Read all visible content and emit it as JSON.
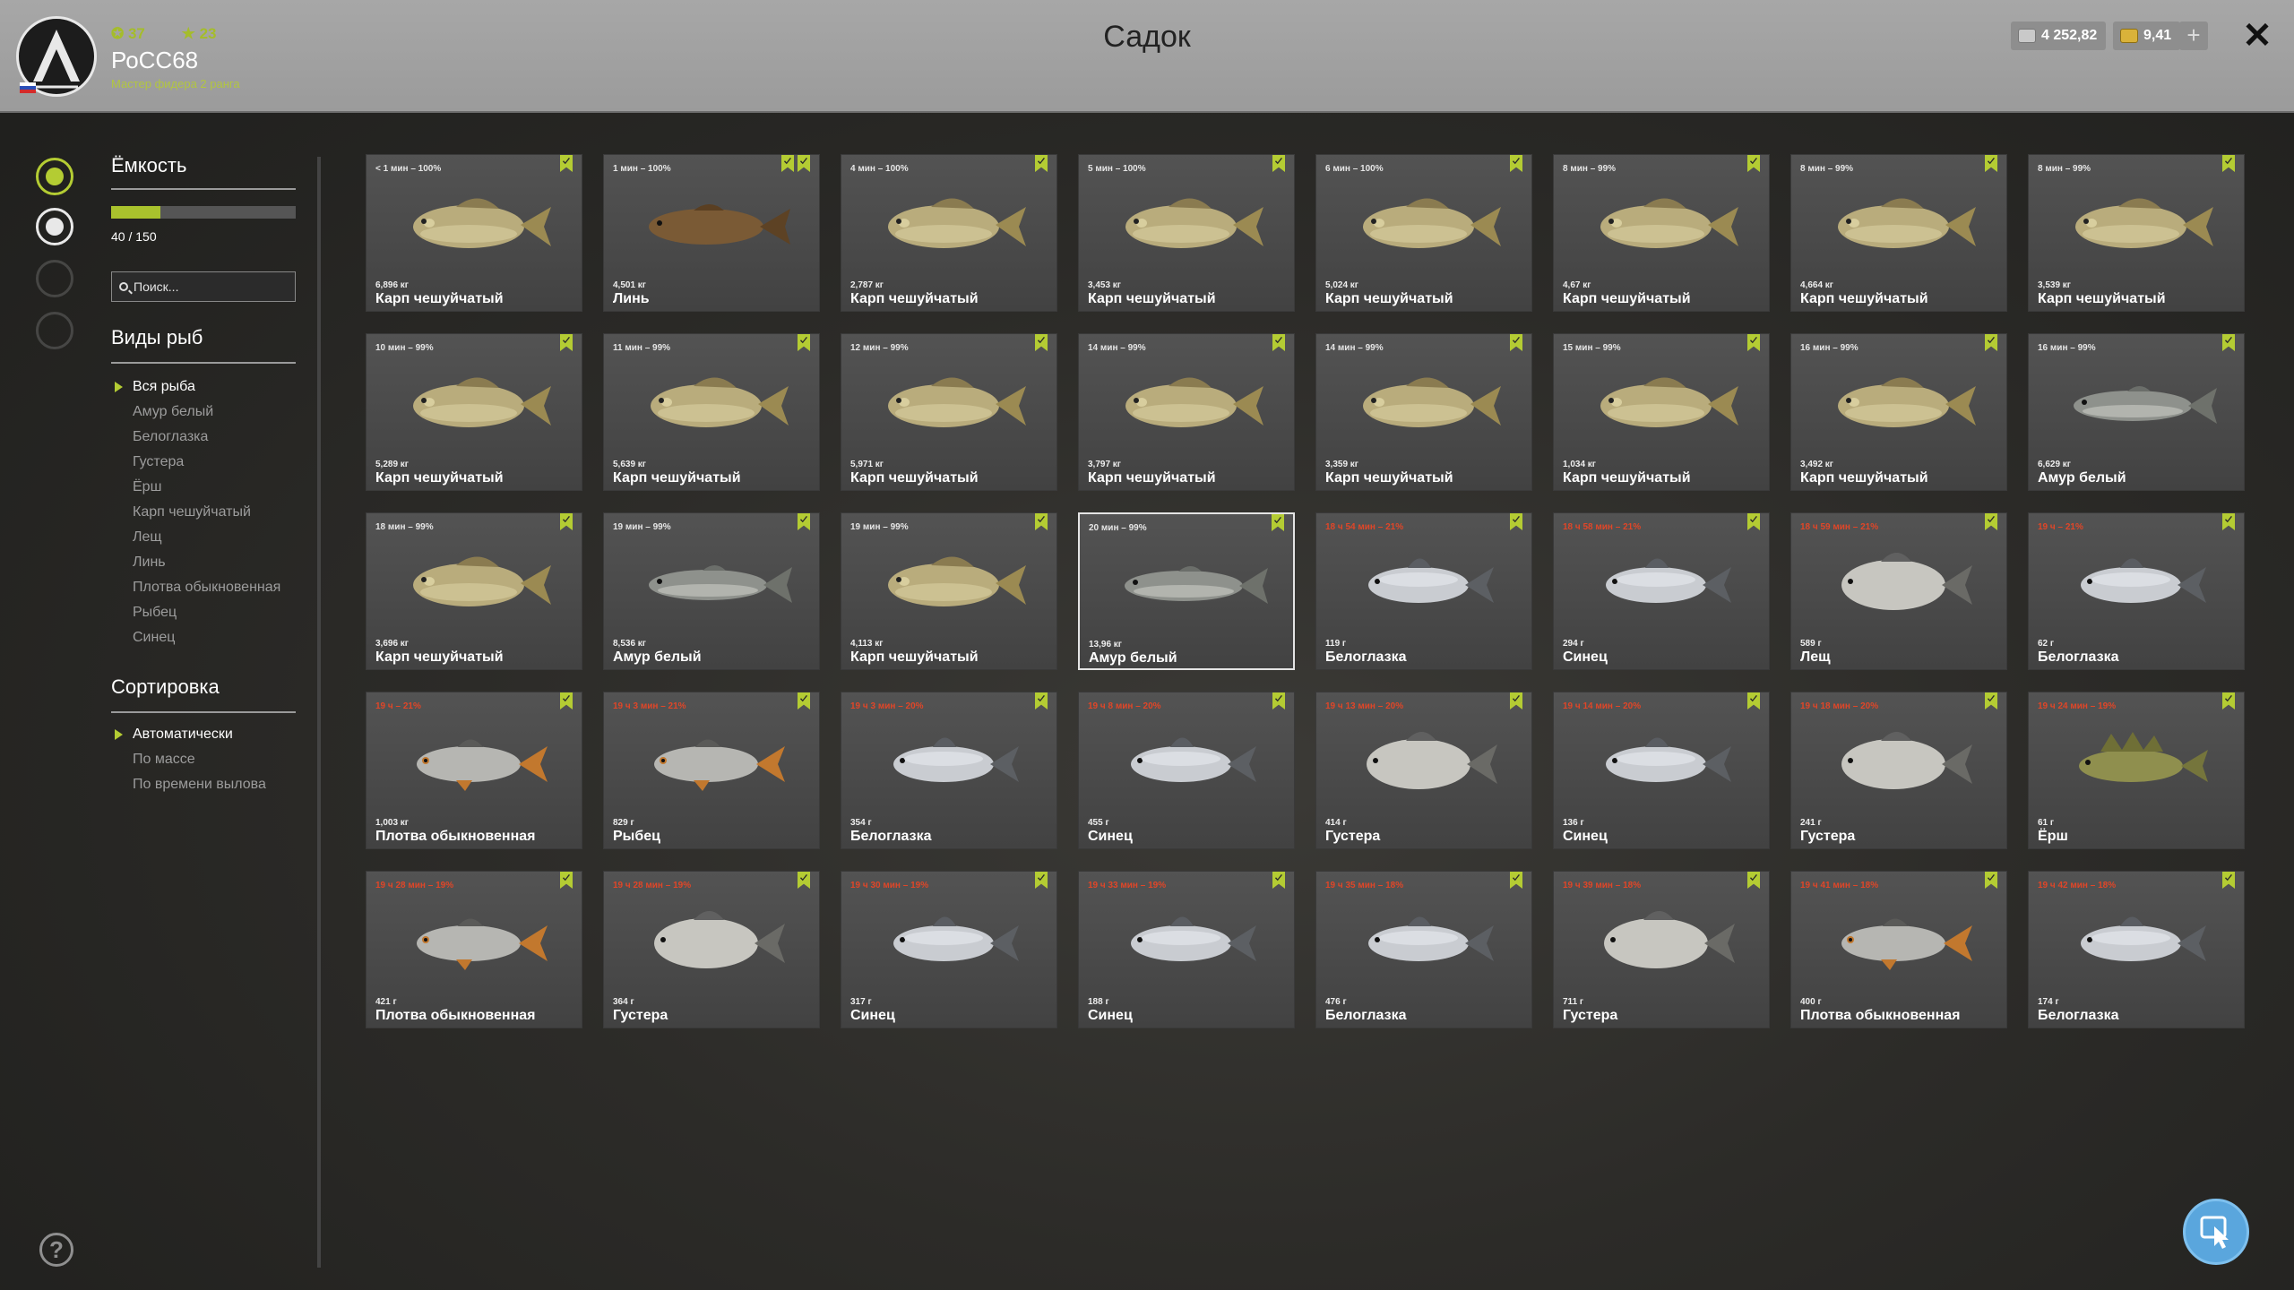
{
  "header": {
    "title": "Садок",
    "player": {
      "name": "РоСС68",
      "level": "37",
      "stars": "23",
      "rank": "Мастер фидера 2 ранга"
    },
    "silver": "4 252,82",
    "gold": "9,41",
    "plus_label": "+",
    "close_label": "✕"
  },
  "sidebar": {
    "capacity_title": "Ёмкость",
    "capacity_text": "40 / 150",
    "capacity_fraction": 0.267,
    "search_placeholder": "Поиск...",
    "species_title": "Виды рыб",
    "species": [
      "Вся рыба",
      "Амур белый",
      "Белоглазка",
      "Густера",
      "Ёрш",
      "Карп чешуйчатый",
      "Лещ",
      "Линь",
      "Плотва обыкновенная",
      "Рыбец",
      "Синец"
    ],
    "sort_title": "Сортировка",
    "sort": [
      "Автоматически",
      "По массе",
      "По времени вылова"
    ],
    "help_label": "?"
  },
  "fish": [
    {
      "time": "< 1 мин – 100%",
      "weight": "6,896 кг",
      "name": "Карп чешуйчатый",
      "red": false,
      "marks": 1,
      "type": "carp"
    },
    {
      "time": "1 мин – 100%",
      "weight": "4,501 кг",
      "name": "Линь",
      "red": false,
      "marks": 2,
      "type": "tench"
    },
    {
      "time": "4 мин – 100%",
      "weight": "2,787 кг",
      "name": "Карп чешуйчатый",
      "red": false,
      "marks": 1,
      "type": "carp"
    },
    {
      "time": "5 мин – 100%",
      "weight": "3,453 кг",
      "name": "Карп чешуйчатый",
      "red": false,
      "marks": 1,
      "type": "carp"
    },
    {
      "time": "6 мин – 100%",
      "weight": "5,024 кг",
      "name": "Карп чешуйчатый",
      "red": false,
      "marks": 1,
      "type": "carp"
    },
    {
      "time": "8 мин – 99%",
      "weight": "4,67 кг",
      "name": "Карп чешуйчатый",
      "red": false,
      "marks": 1,
      "type": "carp"
    },
    {
      "time": "8 мин – 99%",
      "weight": "4,664 кг",
      "name": "Карп чешуйчатый",
      "red": false,
      "marks": 1,
      "type": "carp"
    },
    {
      "time": "8 мин – 99%",
      "weight": "3,539 кг",
      "name": "Карп чешуйчатый",
      "red": false,
      "marks": 1,
      "type": "carp"
    },
    {
      "time": "10 мин – 99%",
      "weight": "5,289 кг",
      "name": "Карп чешуйчатый",
      "red": false,
      "marks": 1,
      "type": "carp"
    },
    {
      "time": "11 мин – 99%",
      "weight": "5,639 кг",
      "name": "Карп чешуйчатый",
      "red": false,
      "marks": 1,
      "type": "carp"
    },
    {
      "time": "12 мин – 99%",
      "weight": "5,971 кг",
      "name": "Карп чешуйчатый",
      "red": false,
      "marks": 1,
      "type": "carp"
    },
    {
      "time": "14 мин – 99%",
      "weight": "3,797 кг",
      "name": "Карп чешуйчатый",
      "red": false,
      "marks": 1,
      "type": "carp"
    },
    {
      "time": "14 мин – 99%",
      "weight": "3,359 кг",
      "name": "Карп чешуйчатый",
      "red": false,
      "marks": 1,
      "type": "carp"
    },
    {
      "time": "15 мин – 99%",
      "weight": "1,034 кг",
      "name": "Карп чешуйчатый",
      "red": false,
      "marks": 1,
      "type": "carp"
    },
    {
      "time": "16 мин – 99%",
      "weight": "3,492 кг",
      "name": "Карп чешуйчатый",
      "red": false,
      "marks": 1,
      "type": "carp"
    },
    {
      "time": "16 мин – 99%",
      "weight": "6,629 кг",
      "name": "Амур белый",
      "red": false,
      "marks": 1,
      "type": "amur"
    },
    {
      "time": "18 мин – 99%",
      "weight": "3,696 кг",
      "name": "Карп чешуйчатый",
      "red": false,
      "marks": 1,
      "type": "carp"
    },
    {
      "time": "19 мин – 99%",
      "weight": "8,536 кг",
      "name": "Амур белый",
      "red": false,
      "marks": 1,
      "type": "amur"
    },
    {
      "time": "19 мин – 99%",
      "weight": "4,113 кг",
      "name": "Карп чешуйчатый",
      "red": false,
      "marks": 1,
      "type": "carp"
    },
    {
      "time": "20 мин – 99%",
      "weight": "13,96 кг",
      "name": "Амур белый",
      "red": false,
      "marks": 1,
      "type": "amur",
      "selected": true
    },
    {
      "time": "18 ч 54 мин – 21%",
      "weight": "119 г",
      "name": "Белоглазка",
      "red": true,
      "marks": 1,
      "type": "silver"
    },
    {
      "time": "18 ч 58 мин – 21%",
      "weight": "294 г",
      "name": "Синец",
      "red": true,
      "marks": 1,
      "type": "silver"
    },
    {
      "time": "18 ч 59 мин – 21%",
      "weight": "589 г",
      "name": "Лещ",
      "red": true,
      "marks": 1,
      "type": "bream"
    },
    {
      "time": "19 ч – 21%",
      "weight": "62 г",
      "name": "Белоглазка",
      "red": true,
      "marks": 1,
      "type": "silver"
    },
    {
      "time": "19 ч – 21%",
      "weight": "1,003 кг",
      "name": "Плотва обыкновенная",
      "red": true,
      "marks": 1,
      "type": "roach"
    },
    {
      "time": "19 ч 3 мин – 21%",
      "weight": "829 г",
      "name": "Рыбец",
      "red": true,
      "marks": 1,
      "type": "roach"
    },
    {
      "time": "19 ч 3 мин – 20%",
      "weight": "354 г",
      "name": "Белоглазка",
      "red": true,
      "marks": 1,
      "type": "silver"
    },
    {
      "time": "19 ч 8 мин – 20%",
      "weight": "455 г",
      "name": "Синец",
      "red": true,
      "marks": 1,
      "type": "silver"
    },
    {
      "time": "19 ч 13 мин – 20%",
      "weight": "414 г",
      "name": "Густера",
      "red": true,
      "marks": 1,
      "type": "bream"
    },
    {
      "time": "19 ч 14 мин – 20%",
      "weight": "136 г",
      "name": "Синец",
      "red": true,
      "marks": 1,
      "type": "silver"
    },
    {
      "time": "19 ч 18 мин – 20%",
      "weight": "241 г",
      "name": "Густера",
      "red": true,
      "marks": 1,
      "type": "bream"
    },
    {
      "time": "19 ч 24 мин – 19%",
      "weight": "61 г",
      "name": "Ёрш",
      "red": true,
      "marks": 1,
      "type": "ruffe"
    },
    {
      "time": "19 ч 28 мин – 19%",
      "weight": "421 г",
      "name": "Плотва обыкновенная",
      "red": true,
      "marks": 1,
      "type": "roach"
    },
    {
      "time": "19 ч 28 мин – 19%",
      "weight": "364 г",
      "name": "Густера",
      "red": true,
      "marks": 1,
      "type": "bream"
    },
    {
      "time": "19 ч 30 мин – 19%",
      "weight": "317 г",
      "name": "Синец",
      "red": true,
      "marks": 1,
      "type": "silver"
    },
    {
      "time": "19 ч 33 мин – 19%",
      "weight": "188 г",
      "name": "Синец",
      "red": true,
      "marks": 1,
      "type": "silver"
    },
    {
      "time": "19 ч 35 мин – 18%",
      "weight": "476 г",
      "name": "Белоглазка",
      "red": true,
      "marks": 1,
      "type": "silver"
    },
    {
      "time": "19 ч 39 мин – 18%",
      "weight": "711 г",
      "name": "Густера",
      "red": true,
      "marks": 1,
      "type": "bream"
    },
    {
      "time": "19 ч 41 мин – 18%",
      "weight": "400 г",
      "name": "Плотва обыкновенная",
      "red": true,
      "marks": 1,
      "type": "roach"
    },
    {
      "time": "19 ч 42 мин – 18%",
      "weight": "174 г",
      "name": "Белоглазка",
      "red": true,
      "marks": 1,
      "type": "silver"
    }
  ]
}
